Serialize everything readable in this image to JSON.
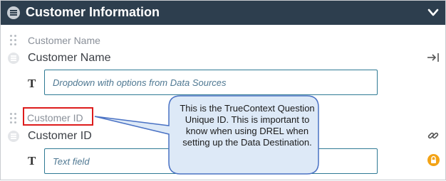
{
  "header": {
    "title": "Customer Information",
    "menu_icon": "list-circle-icon",
    "collapse_icon": "chevron-down-icon"
  },
  "questions": [
    {
      "caption": "Customer Name",
      "name": "Customer Name",
      "type_icon": "text-type-icon",
      "type_glyph": "T",
      "field_placeholder": "Dropdown with options from Data Sources",
      "action_icon": "arrow-to-right-bar-icon"
    },
    {
      "caption": "Customer ID",
      "name": "Customer ID",
      "type_icon": "text-type-icon",
      "type_glyph": "T",
      "field_placeholder": "Text field",
      "action_icon": "link-icon",
      "status_icon": "lock-icon"
    }
  ],
  "callout": {
    "text": "This is the TrueContext Question Unique ID. This is important to know when using DREL when setting up the Data Destination.",
    "highlight_color": "#dd1c1c",
    "fill_color": "#dde9f7",
    "border_color": "#4a72c4"
  },
  "colors": {
    "header_bg": "#2d3e4e",
    "field_border": "#2f7a94",
    "lock_badge": "#f3a316"
  }
}
